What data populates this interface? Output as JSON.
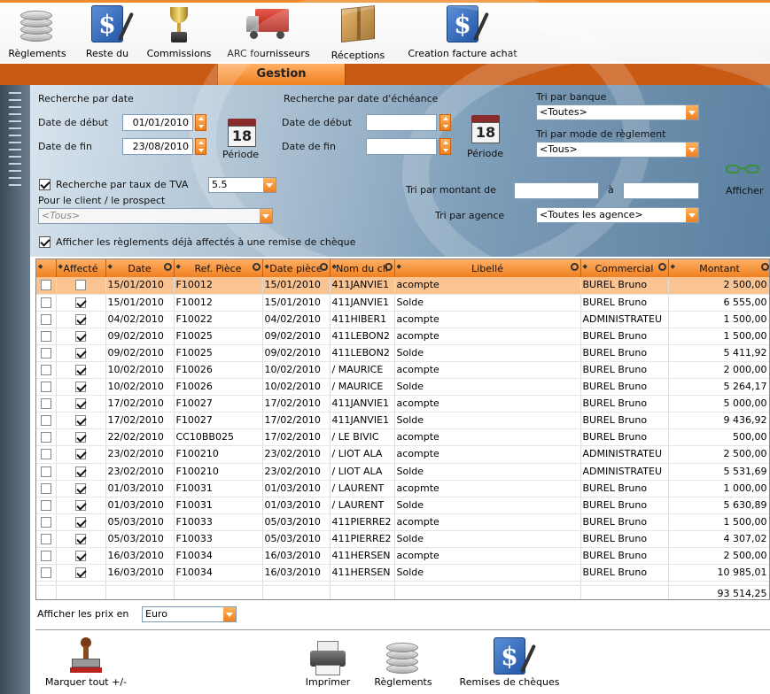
{
  "toolbar": {
    "reglements_label": "Règlements",
    "reste_du_label": "Reste du",
    "commissions_label": "Commissions",
    "arc_label": "ARC fournisseurs",
    "receptions_label": "Réceptions",
    "creation_label": "Creation facture achat"
  },
  "header": {
    "title": "Gestion"
  },
  "search": {
    "recherche_date_label": "Recherche par date",
    "date_debut_label": "Date de début",
    "date_debut_value": "01/01/2010",
    "date_fin_label": "Date de fin",
    "date_fin_value": "23/08/2010",
    "periode_label": "Période",
    "calendar_day": "18",
    "recherche_echeance_label": "Recherche par date d'échéance",
    "ech_debut_label": "Date de début",
    "ech_fin_label": "Date de fin",
    "ech_periode_label": "Période",
    "tri_banque_label": "Tri par banque",
    "tri_banque_value": "<Toutes>",
    "tri_mode_label": "Tri par mode de règlement",
    "tri_mode_value": "<Tous>",
    "afficher_label": "Afficher",
    "tva_label": "Recherche par taux de TVA",
    "tva_value": "5.5",
    "client_label": "Pour le client / le prospect",
    "client_value": "<Tous>",
    "montant_label": "Tri par montant de",
    "montant_a_label": "à",
    "agence_label": "Tri par agence",
    "agence_value": "<Toutes les agence>",
    "affectes_label": "Afficher les règlements déjà affectés à une remise de chèque"
  },
  "grid": {
    "columns": [
      "",
      "Affecté",
      "Date",
      "Ref. Pièce",
      "Date pièce",
      "Nom du cli",
      "Libellé",
      "Commercial",
      "Montant"
    ],
    "rows": [
      [
        "15/01/2010",
        "F10012",
        "15/01/2010",
        "411JANVIE1",
        "acompte",
        "BUREL Bruno",
        "2 500,00"
      ],
      [
        "15/01/2010",
        "F10012",
        "15/01/2010",
        "411JANVIE1",
        "Solde",
        "BUREL Bruno",
        "6 555,00"
      ],
      [
        "04/02/2010",
        "F10022",
        "04/02/2010",
        "411HIBER1",
        "acompte",
        "ADMINISTRATEU",
        "1 500,00"
      ],
      [
        "09/02/2010",
        "F10025",
        "09/02/2010",
        "411LEBON2",
        "acompte",
        "BUREL Bruno",
        "1 500,00"
      ],
      [
        "09/02/2010",
        "F10025",
        "09/02/2010",
        "411LEBON2",
        "Solde",
        "BUREL Bruno",
        "5 411,92"
      ],
      [
        "10/02/2010",
        "F10026",
        "10/02/2010",
        "/ MAURICE",
        "acompte",
        "BUREL Bruno",
        "2 000,00"
      ],
      [
        "10/02/2010",
        "F10026",
        "10/02/2010",
        "/ MAURICE",
        "Solde",
        "BUREL Bruno",
        "5 264,17"
      ],
      [
        "17/02/2010",
        "F10027",
        "17/02/2010",
        "411JANVIE1",
        "acompte",
        "BUREL Bruno",
        "5 000,00"
      ],
      [
        "17/02/2010",
        "F10027",
        "17/02/2010",
        "411JANVIE1",
        "Solde",
        "BUREL Bruno",
        "9 436,92"
      ],
      [
        "22/02/2010",
        "CC10BB025",
        "17/02/2010",
        "/ LE BIVIC",
        "acompte",
        "BUREL Bruno",
        "500,00"
      ],
      [
        "23/02/2010",
        "F100210",
        "23/02/2010",
        "/ LIOT ALA",
        "acompte",
        "ADMINISTRATEU",
        "2 500,00"
      ],
      [
        "23/02/2010",
        "F100210",
        "23/02/2010",
        "/ LIOT ALA",
        "Solde",
        "ADMINISTRATEU",
        "5 531,69"
      ],
      [
        "01/03/2010",
        "F10031",
        "01/03/2010",
        "/ LAURENT",
        "acopmte",
        "BUREL Bruno",
        "1 000,00"
      ],
      [
        "01/03/2010",
        "F10031",
        "01/03/2010",
        "/ LAURENT",
        "Solde",
        "BUREL Bruno",
        "5 630,89"
      ],
      [
        "05/03/2010",
        "F10033",
        "05/03/2010",
        "411PIERRE2",
        "acompte",
        "BUREL Bruno",
        "1 500,00"
      ],
      [
        "05/03/2010",
        "F10033",
        "05/03/2010",
        "411PIERRE2",
        "Solde",
        "BUREL Bruno",
        "4 307,02"
      ],
      [
        "16/03/2010",
        "F10034",
        "16/03/2010",
        "411HERSEN",
        "acompte",
        "BUREL Bruno",
        "2 500,00"
      ],
      [
        "16/03/2010",
        "F10034",
        "16/03/2010",
        "411HERSEN",
        "Solde",
        "BUREL Bruno",
        "10 985,01"
      ]
    ],
    "affecte": [
      false,
      true,
      true,
      true,
      true,
      true,
      true,
      true,
      true,
      true,
      true,
      true,
      true,
      true,
      true,
      true,
      true,
      true
    ],
    "selected_row": 0,
    "total": "93 514,25"
  },
  "bottom": {
    "prix_label": "Afficher les prix en",
    "prix_value": "Euro",
    "marquer_label": "Marquer tout +/-",
    "imprimer_label": "Imprimer",
    "reglements_label": "Règlements",
    "remises_label": "Remises de chèques"
  }
}
